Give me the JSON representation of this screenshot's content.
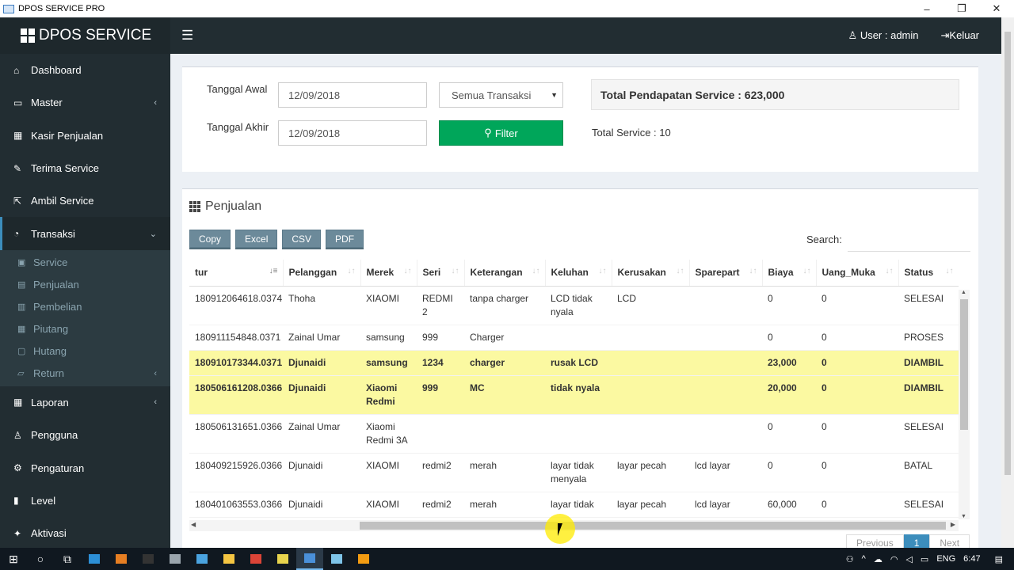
{
  "window": {
    "title": "DPOS SERVICE PRO",
    "minimize": "–",
    "maximize": "❐",
    "close": "✕"
  },
  "header": {
    "brand": "DPOS SERVICE",
    "menu_icon": "☰",
    "user": "User : admin",
    "logout": "Keluar"
  },
  "sidebar": {
    "items": [
      {
        "label": "Dashboard",
        "icon": "home-icon",
        "glyph": "⌂"
      },
      {
        "label": "Master",
        "icon": "monitor-icon",
        "glyph": "▭",
        "chevron": "‹"
      },
      {
        "label": "Kasir Penjualan",
        "icon": "table-icon",
        "glyph": "▦"
      },
      {
        "label": "Terima Service",
        "icon": "wrench-icon",
        "glyph": "✎"
      },
      {
        "label": "Ambil Service",
        "icon": "external-link-icon",
        "glyph": "⇱"
      },
      {
        "label": "Transaksi",
        "icon": "pie-chart-icon",
        "glyph": "◔",
        "chevron": "⌄"
      }
    ],
    "subitems": [
      {
        "label": "Service",
        "icon": "image-icon",
        "glyph": "▣"
      },
      {
        "label": "Penjualan",
        "icon": "briefcase-icon",
        "glyph": "▤"
      },
      {
        "label": "Pembelian",
        "icon": "cart-icon",
        "glyph": "▥"
      },
      {
        "label": "Piutang",
        "icon": "calendar-icon",
        "glyph": "▦"
      },
      {
        "label": "Hutang",
        "icon": "calendar-icon",
        "glyph": "▢"
      },
      {
        "label": "Return",
        "icon": "folder-icon",
        "glyph": "▱",
        "chevron": "‹"
      }
    ],
    "items_bottom": [
      {
        "label": "Laporan",
        "icon": "building-icon",
        "glyph": "▦",
        "chevron": "‹"
      },
      {
        "label": "Pengguna",
        "icon": "user-icon",
        "glyph": "♙"
      },
      {
        "label": "Pengaturan",
        "icon": "gear-icon",
        "glyph": "⚙"
      },
      {
        "label": "Level",
        "icon": "lock-icon",
        "glyph": "▮"
      },
      {
        "label": "Aktivasi",
        "icon": "magic-icon",
        "glyph": "✦"
      }
    ]
  },
  "filter": {
    "start_label": "Tanggal Awal",
    "end_label": "Tanggal Akhir",
    "start_value": "12/09/2018",
    "end_value": "12/09/2018",
    "type_value": "Semua Transaksi",
    "type_caret": "▼",
    "filter_button": "Filter",
    "filter_glyph": "⚲",
    "total_income": "Total Pendapatan Service : 623,000",
    "total_service": "Total Service : 10"
  },
  "sales": {
    "title": "Penjualan",
    "buttons": [
      "Copy",
      "Excel",
      "CSV",
      "PDF"
    ],
    "search_label": "Search:",
    "columns": [
      "tur",
      "Pelanggan",
      "Merek",
      "Seri",
      "Keterangan",
      "Keluhan",
      "Kerusakan",
      "Sparepart",
      "Biaya",
      "Uang_Muka",
      "Status"
    ],
    "sort_glyph": "↓↑",
    "sort_active_glyph": "↓≡",
    "rows": [
      {
        "highlight": false,
        "cells": [
          "180912064618.0374",
          "Thoha",
          "XIAOMI",
          "REDMI 2",
          "tanpa charger",
          "LCD tidak nyala",
          "LCD",
          "",
          "0",
          "0",
          "SELESAI"
        ]
      },
      {
        "highlight": false,
        "cells": [
          "180911154848.0371",
          "Zainal Umar",
          "samsung",
          "999",
          "Charger",
          "",
          "",
          "",
          "0",
          "0",
          "PROSES"
        ]
      },
      {
        "highlight": true,
        "cells": [
          "180910173344.0371",
          "Djunaidi",
          "samsung",
          "1234",
          "charger",
          "rusak LCD",
          "",
          "",
          "23,000",
          "0",
          "DIAMBIL"
        ]
      },
      {
        "highlight": true,
        "cells": [
          "180506161208.0366",
          "Djunaidi",
          "Xiaomi Redmi",
          "999",
          "MC",
          "tidak nyala",
          "",
          "",
          "20,000",
          "0",
          "DIAMBIL"
        ]
      },
      {
        "highlight": false,
        "cells": [
          "180506131651.0366",
          "Zainal Umar",
          "Xiaomi Redmi 3A",
          "",
          "",
          "",
          "",
          "",
          "0",
          "0",
          "SELESAI"
        ]
      },
      {
        "highlight": false,
        "cells": [
          "180409215926.0366",
          "Djunaidi",
          "XIAOMI",
          "redmi2",
          "merah",
          "layar tidak menyala",
          "layar pecah",
          "lcd layar",
          "0",
          "0",
          "BATAL"
        ]
      },
      {
        "highlight": false,
        "cells": [
          "180401063553.0366",
          "Djunaidi",
          "XIAOMI",
          "redmi2",
          "merah",
          "layar tidak",
          "layar pecah",
          "lcd layar",
          "60,000",
          "0",
          "SELESAI"
        ]
      }
    ],
    "pager": {
      "previous": "Previous",
      "current": "1",
      "next": "Next"
    },
    "scroll_up": "▲",
    "scroll_down": "▼",
    "scroll_left": "◀",
    "scroll_right": "▶"
  },
  "taskbar": {
    "start_glyph": "⊞",
    "search_glyph": "○",
    "taskview_glyph": "⧉",
    "apps": [
      {
        "name": "vscode-icon",
        "color": "#2c8fd6"
      },
      {
        "name": "app-orange-icon",
        "color": "#e67e22"
      },
      {
        "name": "cmd-icon",
        "color": "#333333"
      },
      {
        "name": "app-gray-icon",
        "color": "#9aa5ad"
      },
      {
        "name": "store-icon",
        "color": "#4aa3df"
      },
      {
        "name": "explorer-icon",
        "color": "#f4c542"
      },
      {
        "name": "chrome-icon",
        "color": "#db4437"
      },
      {
        "name": "notes-icon",
        "color": "#e8d44d"
      },
      {
        "name": "dpos-icon",
        "color": "#4a90d9"
      },
      {
        "name": "notepad-icon",
        "color": "#7ec4e8"
      },
      {
        "name": "app-orange2-icon",
        "color": "#f39c12"
      }
    ],
    "lang": "ENG",
    "time": "6:47",
    "tray_glyphs": [
      "⚇",
      "^",
      "☁",
      "◠",
      "◁",
      "▭"
    ],
    "notify_glyph": "▤"
  }
}
